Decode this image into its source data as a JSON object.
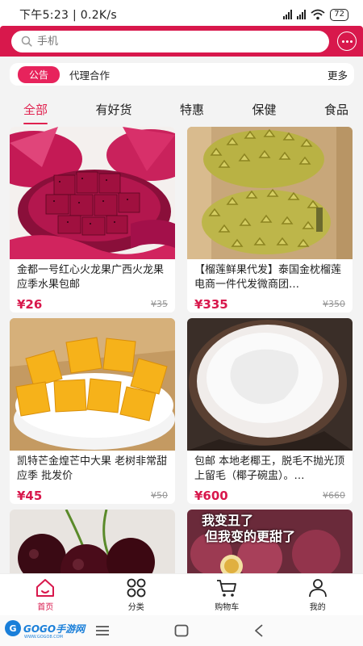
{
  "status_bar": {
    "time": "下午5:23 | 0.2K/s",
    "battery": "72"
  },
  "search": {
    "placeholder": "手机"
  },
  "notice": {
    "badge": "公告",
    "text": "代理合作",
    "more": "更多"
  },
  "tabs": [
    "全部",
    "有好货",
    "特惠",
    "保健",
    "食品"
  ],
  "products": [
    {
      "title": "金都一号红心火龙果广西火龙果应季水果包邮",
      "price": "¥26",
      "old_price": "¥35",
      "image": "dragon-fruit"
    },
    {
      "title": "【榴莲鲜果代发】泰国金枕榴莲电商一件代发微商团…",
      "price": "¥335",
      "old_price": "¥350",
      "image": "durian"
    },
    {
      "title": "凯特芒金煌芒中大果 老树非常甜应季 批发价",
      "price": "¥45",
      "old_price": "¥50",
      "image": "mango"
    },
    {
      "title": "包邮 本地老椰王，脱毛不抛光顶上留毛（椰子碗盅）。…",
      "price": "¥600",
      "old_price": "¥660",
      "image": "coconut"
    },
    {
      "title": "",
      "price": "",
      "old_price": "",
      "image": "cherry"
    },
    {
      "title": "",
      "price": "",
      "old_price": "",
      "image": "passion-fruit",
      "overlay_lines": [
        "我变丑了",
        "但我变的更甜了"
      ]
    }
  ],
  "tabbar": {
    "home": "首页",
    "category": "分类",
    "cart": "购物车",
    "mine": "我的"
  },
  "watermark": {
    "logo_text": "GOGO手游网",
    "logo_sub": "WWW.GOGO8.COM"
  },
  "colors": {
    "accent": "#d8184c",
    "price": "#d8184c",
    "notice_badge": "#e7235c"
  }
}
